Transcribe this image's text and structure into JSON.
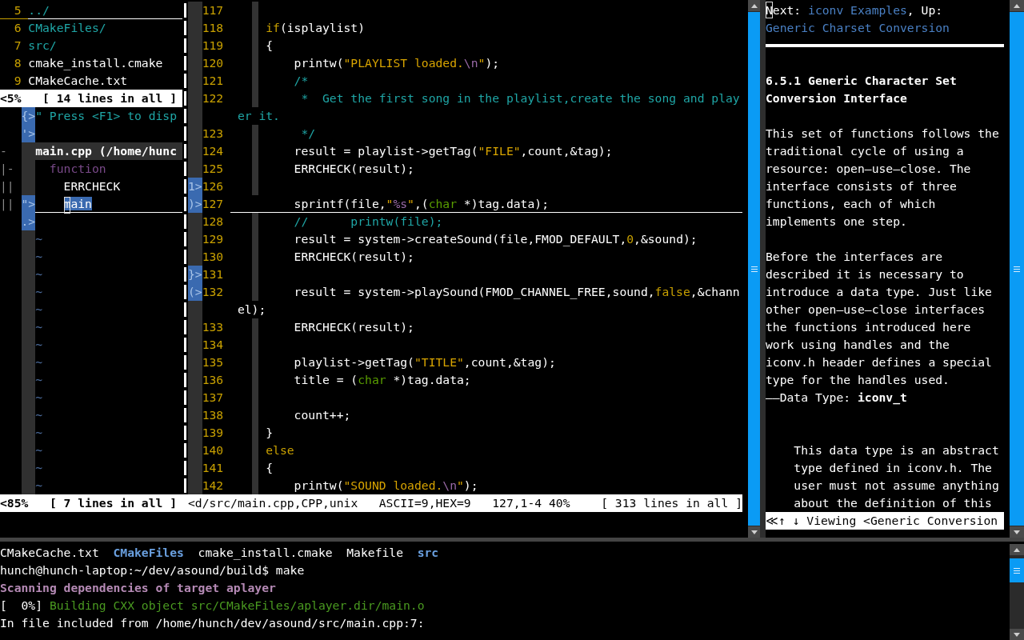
{
  "file_browser": {
    "lines": [
      {
        "number": "5",
        "name": "../",
        "kind": "dir",
        "cursor": true
      },
      {
        "number": "6",
        "name": "CMakeFiles/",
        "kind": "dir",
        "cursor": false
      },
      {
        "number": "7",
        "name": "src/",
        "kind": "dir",
        "cursor": false
      },
      {
        "number": "8",
        "name": "cmake_install.cmake",
        "kind": "file",
        "cursor": false
      },
      {
        "number": "9",
        "name": "CMakeCache.txt",
        "kind": "file",
        "cursor": false
      }
    ],
    "status": {
      "position": "<5%",
      "summary": "[ 14 lines in all ]"
    }
  },
  "taglist": {
    "lines": [
      {
        "kind": "help",
        "sign": "{>",
        "text": "\" Press <F1> to disp",
        "selected": false
      },
      {
        "kind": "blank",
        "sign": "'>",
        "selected": false
      },
      {
        "kind": "file",
        "fold": "-",
        "text": "main.cpp (/home/hunc",
        "selected": false
      },
      {
        "kind": "scope",
        "fold": "|-",
        "text": "function",
        "selected": false
      },
      {
        "kind": "tag",
        "fold": "||",
        "text": "ERRCHECK",
        "selected": false
      },
      {
        "kind": "tag",
        "fold": "||",
        "sign": "\">",
        "text": "main",
        "selected": true
      },
      {
        "kind": "blank",
        "sign": ".>",
        "selected": false
      }
    ],
    "filler": [
      "~",
      "~",
      "~",
      "~",
      "~",
      "~",
      "~",
      "~",
      "~",
      "~",
      "~",
      "~",
      "~",
      "~",
      "~"
    ],
    "status": {
      "position": "<85%",
      "summary": "[ 7 lines in all ]"
    }
  },
  "editor": {
    "lines": [
      {
        "kind": "line",
        "number": "117",
        "guide": true,
        "cursor": false
      },
      {
        "kind": "line",
        "number": "118",
        "guide": true,
        "cursor": false,
        "segments": [
          {
            "text": "    if",
            "kind": "keyword"
          },
          {
            "text": "(isplaylist)",
            "kind": "plain"
          }
        ]
      },
      {
        "kind": "line",
        "number": "119",
        "guide": true,
        "cursor": false,
        "segments": [
          {
            "text": "    {",
            "kind": "plain"
          }
        ]
      },
      {
        "kind": "line",
        "number": "120",
        "guide": true,
        "cursor": false,
        "segments": [
          {
            "text": "        printw(",
            "kind": "plain"
          },
          {
            "text": "\"PLAYLIST loaded.",
            "kind": "string"
          },
          {
            "text": "\\n",
            "kind": "special"
          },
          {
            "text": "\"",
            "kind": "string"
          },
          {
            "text": ");",
            "kind": "plain"
          }
        ]
      },
      {
        "kind": "line",
        "number": "121",
        "guide": true,
        "cursor": false,
        "segments": [
          {
            "text": "        /*",
            "kind": "comment"
          }
        ]
      },
      {
        "kind": "line",
        "number": "122",
        "guide": true,
        "cursor": false,
        "segments": [
          {
            "text": "         *  Get the first song in the playlist,create the song and play",
            "kind": "comment"
          }
        ]
      },
      {
        "kind": "wrap",
        "guide": false,
        "cursor": false,
        "segments": [
          {
            "text": "er it.",
            "kind": "comment"
          }
        ]
      },
      {
        "kind": "line",
        "number": "123",
        "guide": true,
        "cursor": false,
        "segments": [
          {
            "text": "         */",
            "kind": "comment"
          }
        ]
      },
      {
        "kind": "line",
        "number": "124",
        "guide": true,
        "cursor": false,
        "segments": [
          {
            "text": "        result = playlist->getTag(",
            "kind": "plain"
          },
          {
            "text": "\"FILE\"",
            "kind": "string"
          },
          {
            "text": ",count,&tag);",
            "kind": "plain"
          }
        ]
      },
      {
        "kind": "line",
        "number": "125",
        "guide": true,
        "cursor": false,
        "segments": [
          {
            "text": "        ERRCHECK(result);",
            "kind": "plain"
          }
        ]
      },
      {
        "kind": "line",
        "number": "126",
        "sign": "1>",
        "guide": true,
        "cursor": false
      },
      {
        "kind": "line",
        "number": "127",
        "sign": ")>",
        "guide": false,
        "cursor": true,
        "segments": [
          {
            "text": "        sprintf(file,",
            "kind": "plain"
          },
          {
            "text": "\"",
            "kind": "string"
          },
          {
            "text": "%s",
            "kind": "special"
          },
          {
            "text": "\"",
            "kind": "string"
          },
          {
            "text": ",(",
            "kind": "plain"
          },
          {
            "text": "char",
            "kind": "type"
          },
          {
            "text": " *)tag.data);",
            "kind": "plain"
          }
        ]
      },
      {
        "kind": "line",
        "number": "128",
        "guide": true,
        "cursor": false,
        "segments": [
          {
            "text": "        //      printw(file);",
            "kind": "comment"
          }
        ]
      },
      {
        "kind": "line",
        "number": "129",
        "guide": true,
        "cursor": false,
        "segments": [
          {
            "text": "        result = system->createSound(file,FMOD_DEFAULT,",
            "kind": "plain"
          },
          {
            "text": "0",
            "kind": "number"
          },
          {
            "text": ",&sound);",
            "kind": "plain"
          }
        ]
      },
      {
        "kind": "line",
        "number": "130",
        "guide": true,
        "cursor": false,
        "segments": [
          {
            "text": "        ERRCHECK(result);",
            "kind": "plain"
          }
        ]
      },
      {
        "kind": "line",
        "number": "131",
        "sign": "}>",
        "guide": true,
        "cursor": false
      },
      {
        "kind": "line",
        "number": "132",
        "sign": "(>",
        "guide": true,
        "cursor": false,
        "segments": [
          {
            "text": "        result = system->playSound(FMOD_CHANNEL_FREE,sound,",
            "kind": "plain"
          },
          {
            "text": "false",
            "kind": "number"
          },
          {
            "text": ",&chann",
            "kind": "plain"
          }
        ]
      },
      {
        "kind": "wrap",
        "guide": false,
        "cursor": false,
        "segments": [
          {
            "text": "el);",
            "kind": "plain"
          }
        ]
      },
      {
        "kind": "line",
        "number": "133",
        "guide": true,
        "cursor": false,
        "segments": [
          {
            "text": "        ERRCHECK(result);",
            "kind": "plain"
          }
        ]
      },
      {
        "kind": "line",
        "number": "134",
        "guide": true,
        "cursor": false
      },
      {
        "kind": "line",
        "number": "135",
        "guide": true,
        "cursor": false,
        "segments": [
          {
            "text": "        playlist->getTag(",
            "kind": "plain"
          },
          {
            "text": "\"TITLE\"",
            "kind": "string"
          },
          {
            "text": ",count,&tag);",
            "kind": "plain"
          }
        ]
      },
      {
        "kind": "line",
        "number": "136",
        "guide": true,
        "cursor": false,
        "segments": [
          {
            "text": "        title = (",
            "kind": "plain"
          },
          {
            "text": "char",
            "kind": "type"
          },
          {
            "text": " *)tag.data;",
            "kind": "plain"
          }
        ]
      },
      {
        "kind": "line",
        "number": "137",
        "guide": true,
        "cursor": false
      },
      {
        "kind": "line",
        "number": "138",
        "guide": true,
        "cursor": false,
        "segments": [
          {
            "text": "        count++;",
            "kind": "plain"
          }
        ]
      },
      {
        "kind": "line",
        "number": "139",
        "guide": true,
        "cursor": false,
        "segments": [
          {
            "text": "    }",
            "kind": "plain"
          }
        ]
      },
      {
        "kind": "line",
        "number": "140",
        "guide": true,
        "cursor": false,
        "segments": [
          {
            "text": "    else",
            "kind": "keyword"
          }
        ]
      },
      {
        "kind": "line",
        "number": "141",
        "guide": true,
        "cursor": false,
        "segments": [
          {
            "text": "    {",
            "kind": "plain"
          }
        ]
      },
      {
        "kind": "line",
        "number": "142",
        "guide": true,
        "cursor": false,
        "segments": [
          {
            "text": "        printw(",
            "kind": "plain"
          },
          {
            "text": "\"SOUND loaded.",
            "kind": "string"
          },
          {
            "text": "\\n",
            "kind": "special"
          },
          {
            "text": "\"",
            "kind": "string"
          },
          {
            "text": ");",
            "kind": "plain"
          }
        ]
      }
    ],
    "status": {
      "file": "<d/src/main.cpp,CPP,unix",
      "char": "ASCII=9,HEX=9",
      "position": "127,1-4 40%",
      "summary": "[ 313 lines in all ]"
    }
  },
  "info": {
    "nav": [
      {
        "text": "Next: ",
        "kind": "label"
      },
      {
        "text": "iconv Examples",
        "kind": "link"
      },
      {
        "text": ", Up: ",
        "kind": "label"
      },
      {
        "text": "Generic Charset Conversion",
        "kind": "link"
      }
    ],
    "heading": "6.5.1 Generic Character Set Conversion Interface",
    "paragraphs": [
      "This set of functions follows the traditional cycle of using a resource: open—use—close. The interface consists of three functions, each of which implements one step.",
      "Before the interfaces are described it is necessary to introduce a data type. Just like other open—use—close interfaces the functions introduced here work using handles and the iconv.h header defines a special type for the handles used."
    ],
    "definition": "——Data Type: **iconv_t**",
    "description": "This data type is an abstract type defined in iconv.h. The user must not assume anything about the definition of this",
    "status": "≪↑ ↓ Viewing <Generic Conversion"
  },
  "terminal": {
    "lines": [
      {
        "kind": "listing",
        "entries": [
          {
            "name": "CMakeCache.txt",
            "kind": "file"
          },
          {
            "name": "CMakeFiles",
            "kind": "dir"
          },
          {
            "name": "cmake_install.cmake",
            "kind": "file"
          },
          {
            "name": "Makefile",
            "kind": "file"
          },
          {
            "name": "src",
            "kind": "dir"
          }
        ]
      },
      {
        "kind": "prompt",
        "prompt": "hunch@hunch-laptop:~/dev/asound/build$",
        "command": "make"
      },
      {
        "kind": "status",
        "text": "Scanning dependencies of target aplayer"
      },
      {
        "kind": "progress",
        "percent": "[  0%]",
        "text": "Building CXX object src/CMakeFiles/aplayer.dir/main.o"
      },
      {
        "kind": "output",
        "text": "In file included from /home/hunch/dev/asound/src/main.cpp:7:"
      }
    ]
  }
}
